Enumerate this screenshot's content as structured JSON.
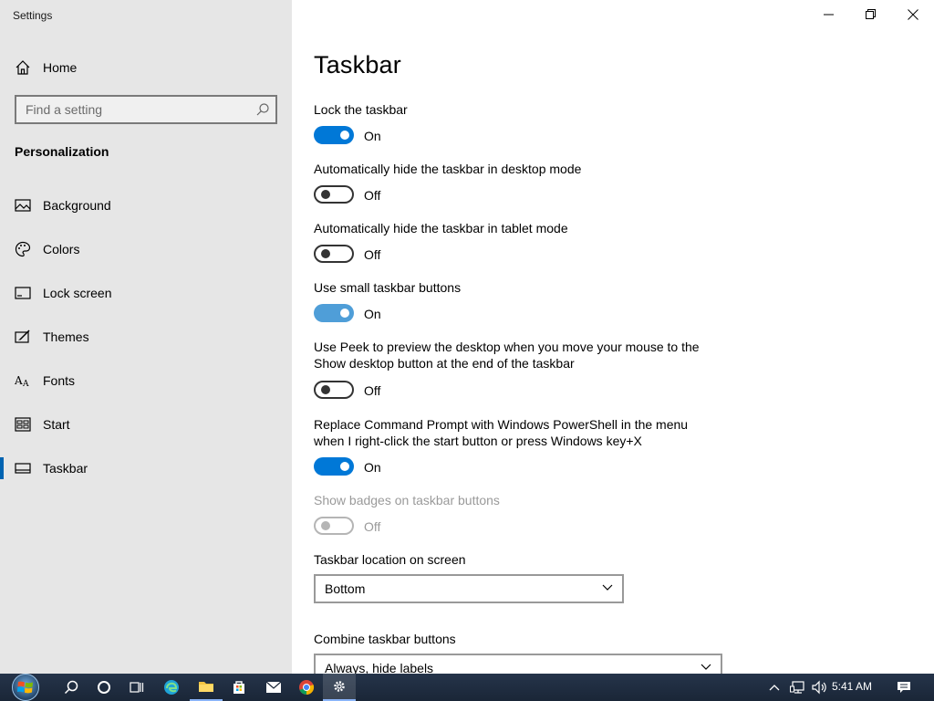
{
  "window": {
    "title": "Settings"
  },
  "sidebar": {
    "home_label": "Home",
    "search_placeholder": "Find a setting",
    "section_title": "Personalization",
    "items": [
      {
        "label": "Background",
        "icon": "picture-icon"
      },
      {
        "label": "Colors",
        "icon": "palette-icon"
      },
      {
        "label": "Lock screen",
        "icon": "lock-screen-icon"
      },
      {
        "label": "Themes",
        "icon": "themes-icon"
      },
      {
        "label": "Fonts",
        "icon": "fonts-icon"
      },
      {
        "label": "Start",
        "icon": "start-icon"
      },
      {
        "label": "Taskbar",
        "icon": "taskbar-icon",
        "active": true
      }
    ]
  },
  "main": {
    "title": "Taskbar",
    "settings": [
      {
        "label": "Lock the taskbar",
        "state": "On"
      },
      {
        "label": "Automatically hide the taskbar in desktop mode",
        "state": "Off"
      },
      {
        "label": "Automatically hide the taskbar in tablet mode",
        "state": "Off"
      },
      {
        "label": "Use small taskbar buttons",
        "state": "On"
      },
      {
        "label": "Use Peek to preview the desktop when you move your mouse to the Show desktop button at the end of the taskbar",
        "state": "Off"
      },
      {
        "label": "Replace Command Prompt with Windows PowerShell in the menu when I right-click the start button or press Windows key+X",
        "state": "On"
      },
      {
        "label": "Show badges on taskbar buttons",
        "state": "Off",
        "disabled": true
      }
    ],
    "location": {
      "label": "Taskbar location on screen",
      "value": "Bottom"
    },
    "combine": {
      "label": "Combine taskbar buttons",
      "value": "Always, hide labels"
    }
  },
  "taskbar": {
    "clock": "5:41 AM",
    "accent": "#0078d7"
  }
}
